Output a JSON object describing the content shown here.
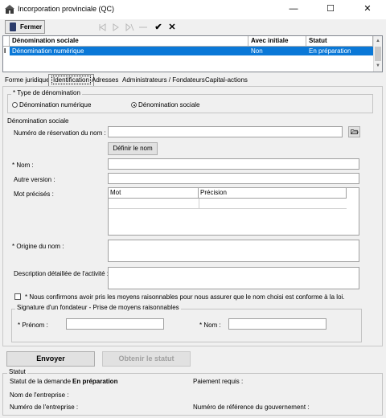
{
  "window": {
    "title": "Incorporation provinciale (QC)",
    "min_glyph": "—",
    "max_glyph": "☐",
    "close_glyph": "✕"
  },
  "toolbar": {
    "close_label": "Fermer",
    "icons": [
      "first-icon",
      "prev-icon",
      "next-icon",
      "last-icon",
      "check-icon",
      "delete-icon"
    ],
    "check_glyph": "✔",
    "delete_glyph": "✕"
  },
  "grid": {
    "columns": [
      "Dénomination sociale",
      "Avec initiale",
      "Statut"
    ],
    "rows": [
      {
        "indicator": "I",
        "denomination": "Dénomination numérique",
        "initiale": "Non",
        "statut": "En préparation"
      }
    ]
  },
  "tabs": [
    "Forme juridique",
    "Identification",
    "Adresses",
    "Administrateurs / Fondateurs",
    "Capital-actions"
  ],
  "active_tab": "Identification",
  "type_group": {
    "title": "* Type de dénomination",
    "options": [
      "Dénomination numérique",
      "Dénomination sociale"
    ],
    "selected": "Dénomination sociale"
  },
  "denom_group": {
    "title": "Dénomination sociale",
    "reservation_label": "Numéro de réservation du nom :",
    "reservation_value": "",
    "define_button": "Définir le nom",
    "nom_label": "* Nom :",
    "nom_value": "",
    "autre_label": "Autre version :",
    "autre_value": "",
    "mots_label": "Mot précisés :",
    "mots_columns": [
      "Mot",
      "Précision"
    ],
    "origine_label": "* Origine du nom :",
    "origine_value": "",
    "description_label": "Description détaillée de l'activité :",
    "description_value": "",
    "confirm_label": "* Nous confirmons avoir pris les moyens raisonnables pour nous assurer que le nom choisi est conforme à la loi.",
    "confirm_checked": false
  },
  "signature_group": {
    "title": "Signature d'un fondateur - Prise de moyens raisonnables",
    "prenom_label": "* Prénom :",
    "prenom_value": "",
    "nom_label": "* Nom :",
    "nom_value": ""
  },
  "actions": {
    "send": "Envoyer",
    "status": "Obtenir le statut"
  },
  "statut": {
    "title": "Statut",
    "demande_label": "Statut de la demande :",
    "demande_value": "En préparation",
    "paiement_label": "Paiement requis :",
    "nom_entreprise_label": "Nom de l'entreprise :",
    "numero_entreprise_label": "Numéro de l'entreprise :",
    "numero_reference_label": "Numéro de référence du gouvernement :"
  }
}
